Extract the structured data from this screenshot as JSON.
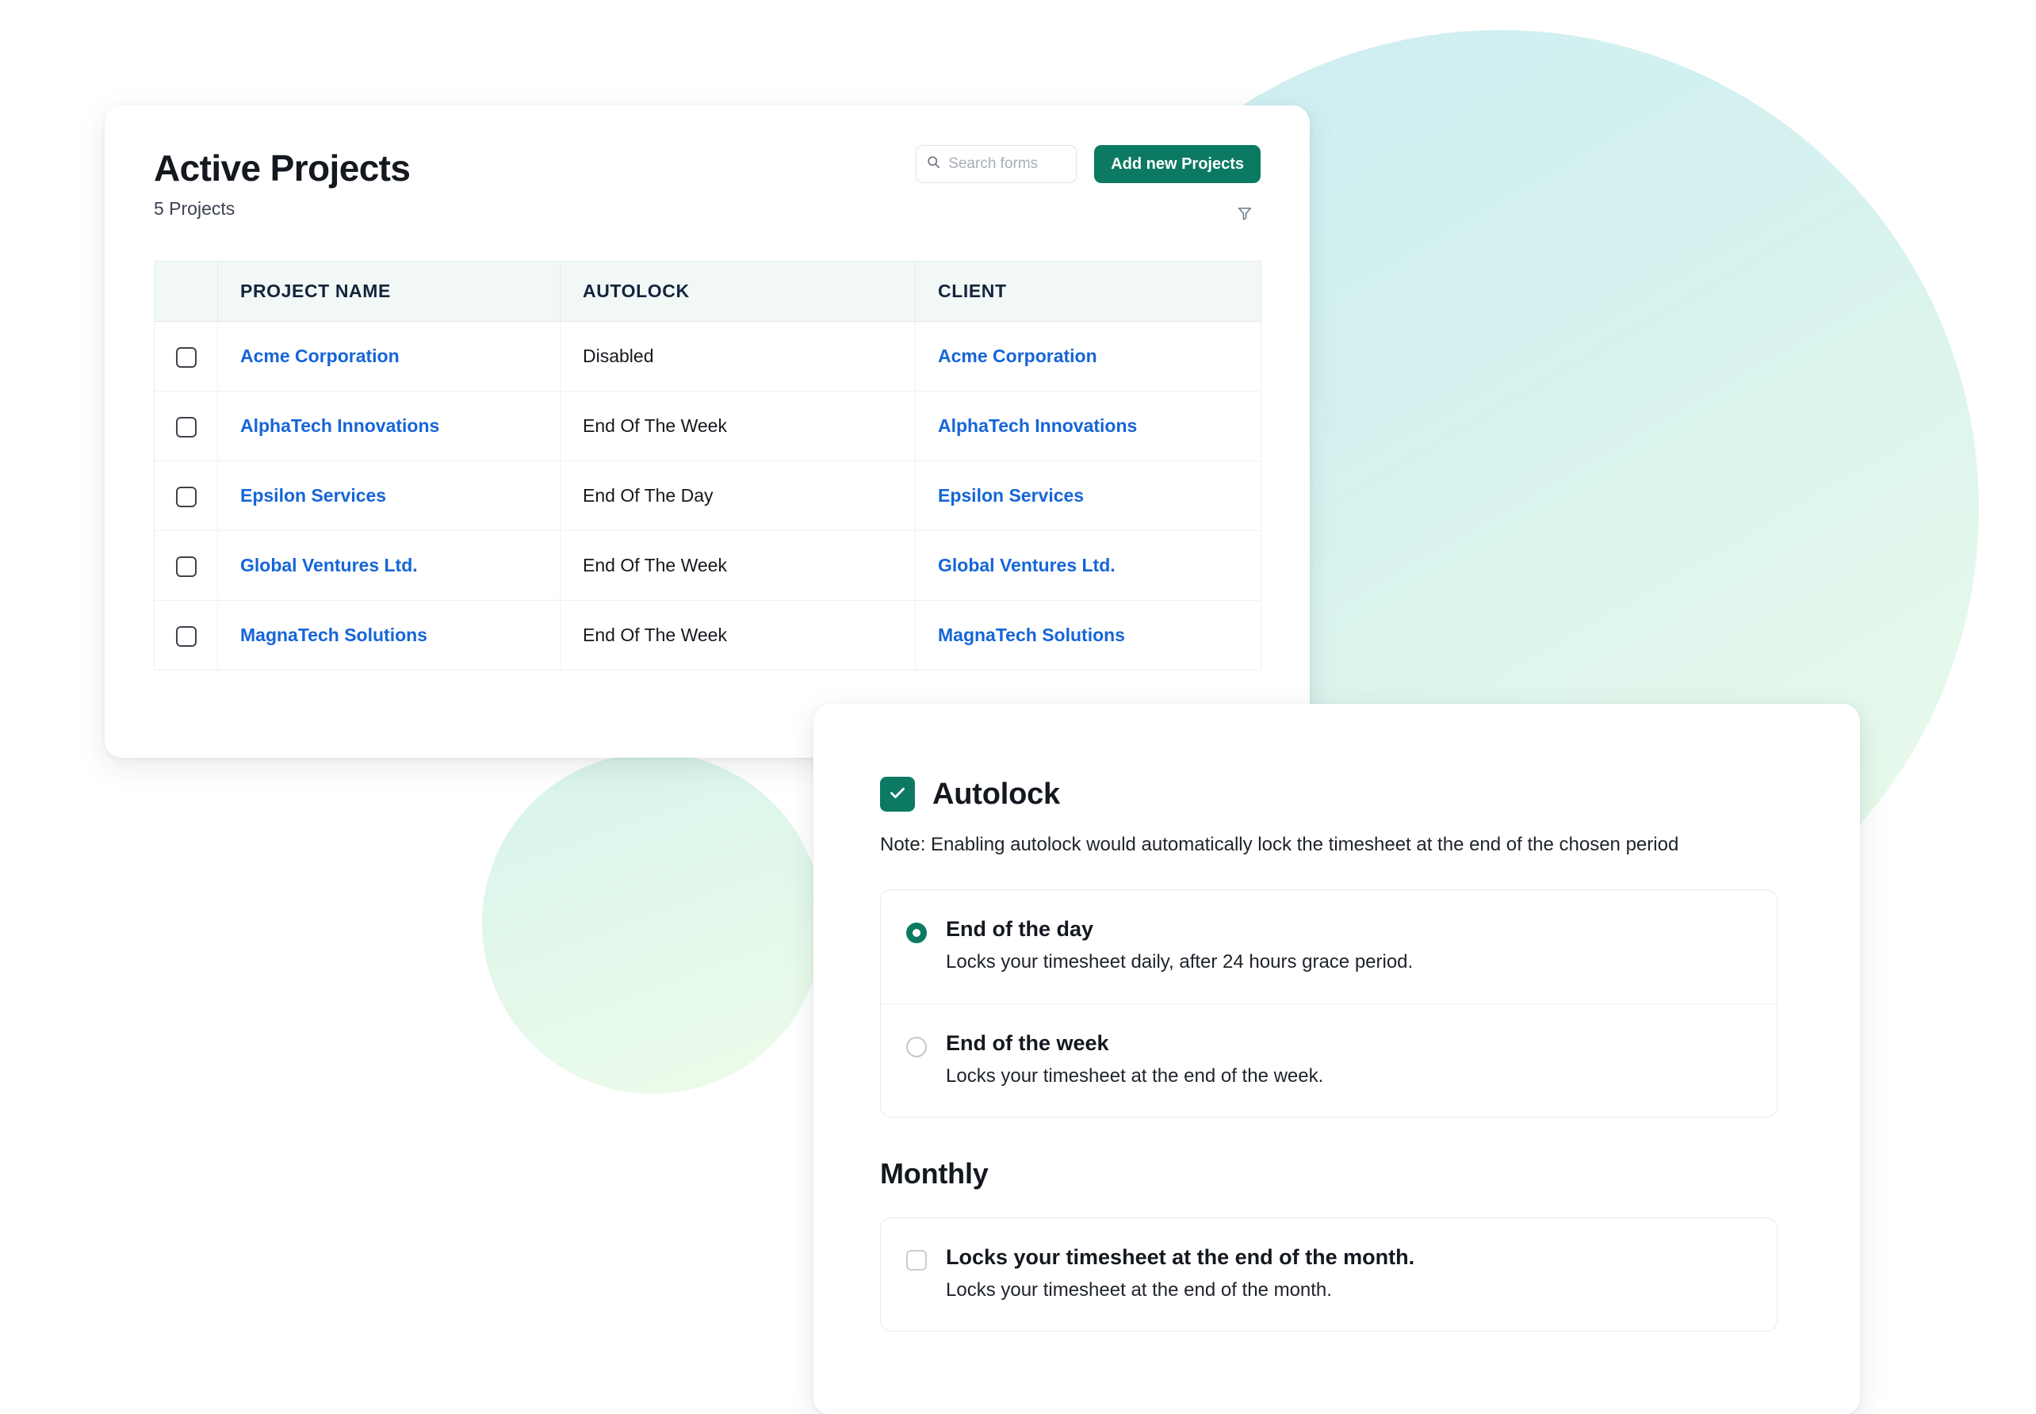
{
  "colors": {
    "brand_green": "#0c7a62",
    "link_blue": "#1565d8",
    "table_header_bg": "#f1f8f6",
    "header_text": "#16243c"
  },
  "projects_card": {
    "title": "Active Projects",
    "subtitle": "5 Projects",
    "search": {
      "placeholder": "Search forms",
      "value": "",
      "icon": "search-icon"
    },
    "add_button_label": "Add new Projects",
    "filter_icon": "filter-funnel-icon",
    "table": {
      "columns": [
        "PROJECT NAME",
        "AUTOLOCK",
        "CLIENT"
      ],
      "rows": [
        {
          "checked": false,
          "project_name": "Acme Corporation",
          "autolock": "Disabled",
          "client": "Acme Corporation"
        },
        {
          "checked": false,
          "project_name": "AlphaTech Innovations",
          "autolock": "End Of The Week",
          "client": "AlphaTech Innovations"
        },
        {
          "checked": false,
          "project_name": "Epsilon Services",
          "autolock": "End Of The Day",
          "client": "Epsilon Services"
        },
        {
          "checked": false,
          "project_name": "Global Ventures Ltd.",
          "autolock": "End Of The Week",
          "client": "Global Ventures Ltd."
        },
        {
          "checked": false,
          "project_name": "MagnaTech Solutions",
          "autolock": "End Of The Week",
          "client": "MagnaTech Solutions"
        }
      ]
    }
  },
  "autolock_card": {
    "checkbox_checked": true,
    "title": "Autolock",
    "note": "Note: Enabling autolock would automatically lock the timesheet at the end of the chosen period",
    "options": [
      {
        "selected": true,
        "label": "End of the day",
        "description": "Locks your timesheet daily, after 24 hours grace period."
      },
      {
        "selected": false,
        "label": "End of the week",
        "description": "Locks your timesheet at the end of the week."
      }
    ],
    "monthly": {
      "section_title": "Monthly",
      "checked": false,
      "label": "Locks your timesheet at the end of the month.",
      "description": "Locks your timesheet at the end of the month."
    }
  }
}
